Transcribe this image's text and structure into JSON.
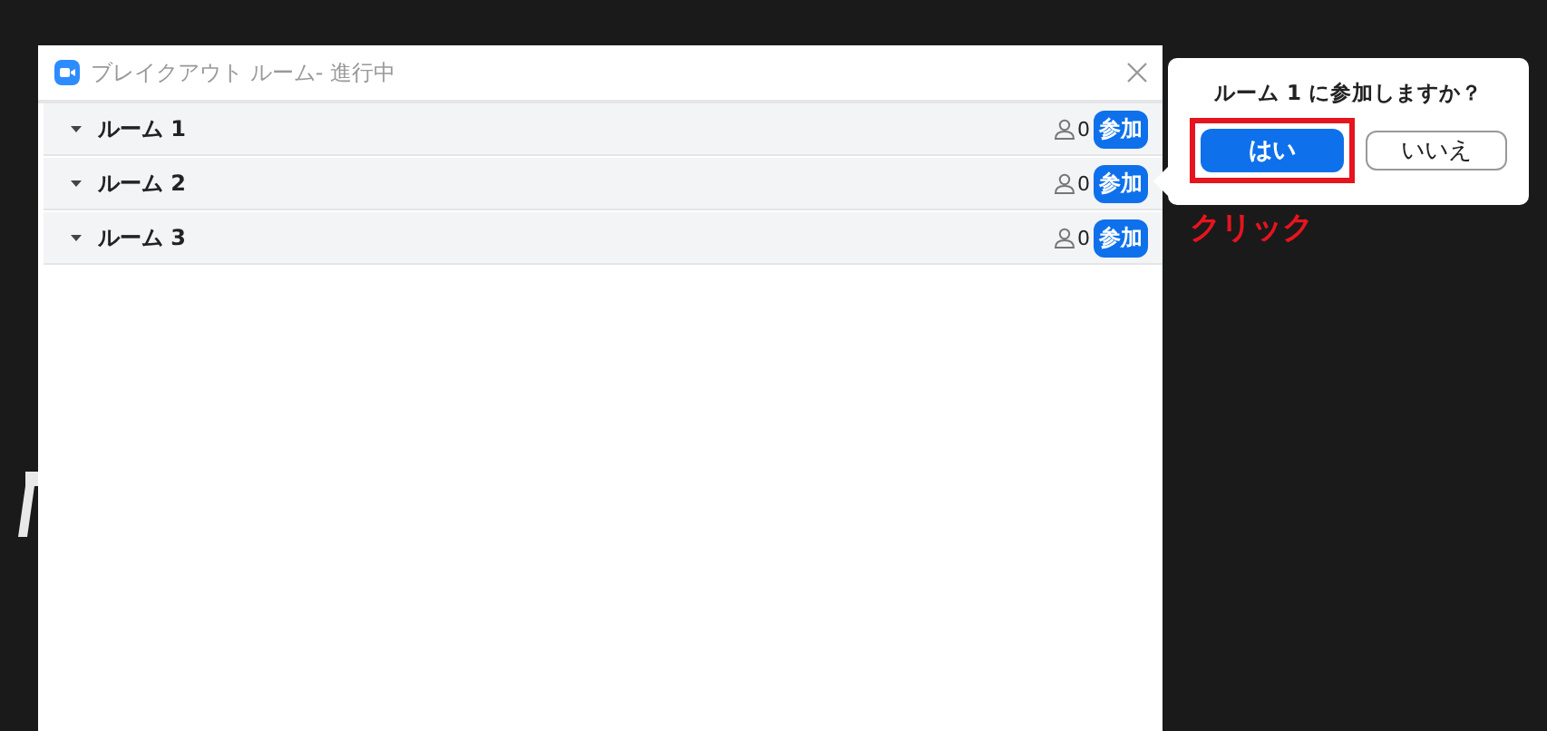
{
  "window": {
    "title": "ブレイクアウト ルーム- 進行中"
  },
  "rooms": [
    {
      "name": "ルーム 1",
      "participants": "0",
      "join": "参加",
      "expanded": true
    },
    {
      "name": "ルーム 2",
      "participants": "0",
      "join": "参加",
      "expanded": true
    },
    {
      "name": "ルーム 3",
      "participants": "0",
      "join": "参加",
      "expanded": true
    }
  ],
  "popover": {
    "question": "ルーム 1 に参加しますか？",
    "buttons": [
      {
        "label": "はい",
        "kind": "primary"
      },
      {
        "label": "いいえ",
        "kind": "secondary"
      }
    ]
  },
  "annotation": {
    "label": "クリック"
  }
}
